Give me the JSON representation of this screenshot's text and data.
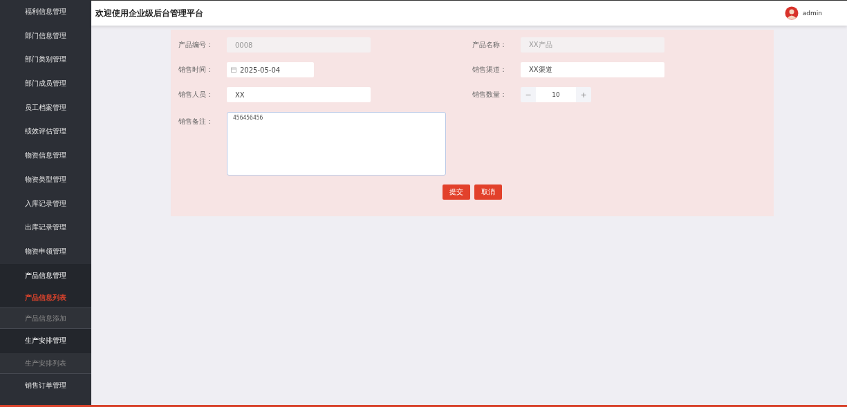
{
  "header": {
    "title": "欢迎使用企业级后台管理平台",
    "user": "admin"
  },
  "sidebar": {
    "items": [
      {
        "label": "福利信息管理",
        "expanded": false
      },
      {
        "label": "部门信息管理",
        "expanded": false
      },
      {
        "label": "部门类别管理",
        "expanded": false
      },
      {
        "label": "部门成员管理",
        "expanded": false
      },
      {
        "label": "员工档案管理",
        "expanded": false
      },
      {
        "label": "绩效评估管理",
        "expanded": false
      },
      {
        "label": "物资信息管理",
        "expanded": false
      },
      {
        "label": "物资类型管理",
        "expanded": false
      },
      {
        "label": "入库记录管理",
        "expanded": false
      },
      {
        "label": "出库记录管理",
        "expanded": false
      },
      {
        "label": "物资申领管理",
        "expanded": false
      },
      {
        "label": "产品信息管理",
        "expanded": true,
        "children": [
          {
            "label": "产品信息列表",
            "selected": true
          },
          {
            "label": "产品信息添加",
            "selected": false
          }
        ]
      },
      {
        "label": "生产安排管理",
        "expanded": true,
        "children": [
          {
            "label": "生产安排列表",
            "selected": false
          }
        ]
      },
      {
        "label": "销售订单管理",
        "expanded": false
      }
    ]
  },
  "form": {
    "fields": [
      {
        "label": "产品编号：",
        "kind": "text",
        "value": "0008",
        "disabled": true
      },
      {
        "label": "产品名称：",
        "kind": "text",
        "value": "XX产品",
        "disabled": true
      },
      {
        "label": "销售时间：",
        "kind": "date",
        "value": "2025-05-04",
        "disabled": false
      },
      {
        "label": "销售渠道：",
        "kind": "text",
        "value": "XX渠道",
        "disabled": false
      },
      {
        "label": "销售人员：",
        "kind": "text",
        "value": "XX",
        "disabled": false
      },
      {
        "label": "销售数量：",
        "kind": "number",
        "value": "10",
        "minus": "−",
        "plus": "+",
        "disabled": false
      },
      {
        "label": "销售备注：",
        "kind": "textarea",
        "value": "456456456",
        "disabled": false
      }
    ],
    "buttons": [
      "提交",
      "取消"
    ]
  }
}
